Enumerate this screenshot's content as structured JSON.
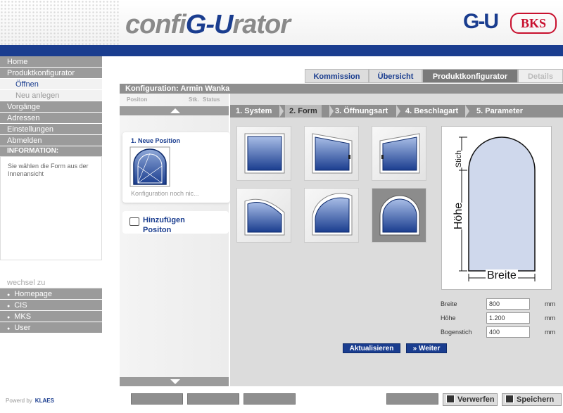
{
  "header": {
    "logo_text_a": "confi",
    "logo_text_gu": "G-U",
    "logo_text_b": "rator",
    "brand_gu": "G-U",
    "brand_bks": "BKS"
  },
  "nav": {
    "home": "Home",
    "produktkonfigurator": "Produktkonfigurator",
    "oeffnen": "Öffnen",
    "neu_anlegen": "Neu anlegen",
    "vorgaenge": "Vorgänge",
    "adressen": "Adressen",
    "einstellungen": "Einstellungen",
    "abmelden": "Abmelden"
  },
  "information": {
    "title": "INFORMATION:",
    "text": "Sie wählen die Form aus der Innenansicht"
  },
  "wechsel": {
    "title": "wechsel zu",
    "items": [
      "Homepage",
      "CIS",
      "MKS",
      "User"
    ]
  },
  "powered": {
    "label": "Powerd by",
    "brand": "KLAES"
  },
  "tabs": {
    "kommission": "Kommission",
    "uebersicht": "Übersicht",
    "produktkonfigurator": "Produktkonfigurator",
    "details": "Details"
  },
  "config_title": "Konfiguration: Armin Wanka",
  "positions": {
    "col_position": "Positon",
    "col_stk": "Stk.",
    "col_status": "Status",
    "card_title": "1. Neue Position",
    "card_text": "Konfiguration noch nic...",
    "add_line1": "Hinzufügen",
    "add_line2": "Positon"
  },
  "steps": [
    "1. System",
    "2. Form",
    "3. Öffnungsart",
    "4. Beschlagart",
    "5. Parameter"
  ],
  "shapes": [
    "rectangle",
    "slant-top-right",
    "slant-top-left",
    "segment-arch-right",
    "quarter-arch",
    "round-arch"
  ],
  "drawing": {
    "stich": "Stich",
    "hoehe": "Höhe",
    "breite": "Breite"
  },
  "params": {
    "breite_label": "Breite",
    "breite_value": "800",
    "hoehe_label": "Höhe",
    "hoehe_value": "1.200",
    "bogenstich_label": "Bogenstich",
    "bogenstich_value": "400",
    "unit": "mm"
  },
  "buttons": {
    "aktualisieren": "Aktualisieren",
    "weiter": "» Weiter",
    "verwerfen": "Verwerfen",
    "speichern": "Speichern"
  },
  "colors": {
    "brand_blue": "#1a3d8f",
    "bks_red": "#c8102e",
    "panel_gray": "#8f8f8f"
  }
}
